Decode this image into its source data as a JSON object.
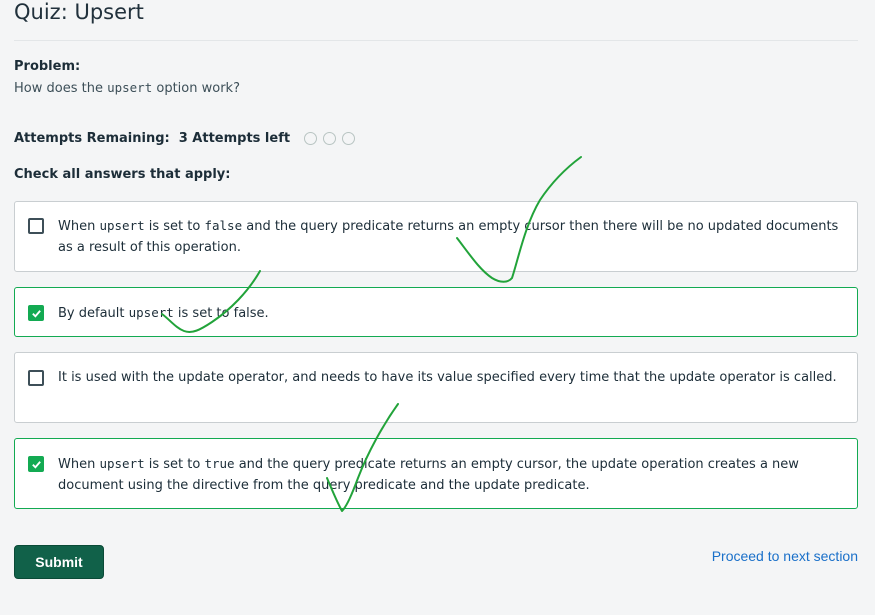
{
  "header": {
    "title": "Quiz: Upsert"
  },
  "problem": {
    "label": "Problem:",
    "text_pre": "How does the ",
    "text_code": "upsert",
    "text_post": " option work?"
  },
  "attempts": {
    "label": "Attempts Remaining:",
    "count": "3 Attempts left",
    "indicators": 3
  },
  "instruction": "Check all answers that apply:",
  "options": [
    {
      "checked": false,
      "parts": [
        "When ",
        "upsert",
        " is set to ",
        "false",
        " and the query predicate returns an empty cursor then there will be no updated documents as a result of this operation."
      ]
    },
    {
      "checked": true,
      "parts": [
        "By default ",
        "upsert",
        " is set to false."
      ]
    },
    {
      "checked": false,
      "parts": [
        "It is used with the update operator, and needs to have its value specified every time that the update operator is called."
      ]
    },
    {
      "checked": true,
      "parts": [
        "When ",
        "upsert",
        " is set to ",
        "true",
        " and the query predicate returns an empty cursor, the update operation creates a new document using the directive from the query predicate and the update predicate."
      ]
    }
  ],
  "actions": {
    "submit_label": "Submit",
    "proceed_label": "Proceed to next section"
  },
  "colors": {
    "accent_green": "#13aa52",
    "submit_bg": "#116149",
    "link_blue": "#1a70c9",
    "annotation_ink": "#22a33a"
  }
}
